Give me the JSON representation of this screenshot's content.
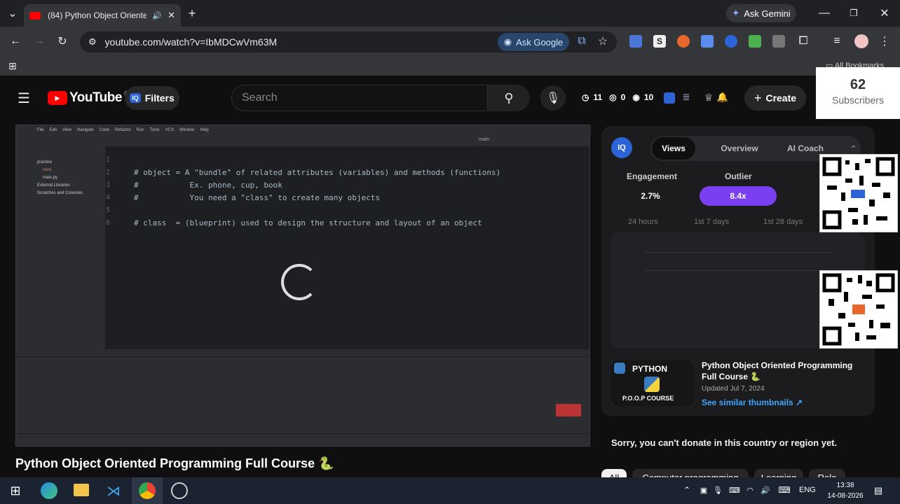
{
  "browser": {
    "tab_title": "(84) Python Object Oriented",
    "new_tab_symbol": "+",
    "ask_gemini": "Ask Gemini",
    "url": "youtube.com/watch?v=IbMDCwVm63M",
    "ask_google": "Ask Google",
    "all_bookmarks": "All Bookmarks"
  },
  "youtube": {
    "logo_text": "YouTube",
    "region": "IN",
    "filters_label": "Filters",
    "search_placeholder": "Search",
    "stat1": "11",
    "stat2": "0",
    "stat3": "10",
    "create_label": "Create",
    "subscribers_count": "62",
    "subscribers_label": "Subscribers"
  },
  "ide": {
    "lines": [
      {
        "n": "1",
        "text": ""
      },
      {
        "n": "2",
        "text": "# object = A \"bundle\" of related attributes (variables) and methods (functions)"
      },
      {
        "n": "3",
        "text": "#           Ex. phone, cup, book"
      },
      {
        "n": "4",
        "text": "#           You need a \"class\" to create many objects"
      },
      {
        "n": "5",
        "text": ""
      },
      {
        "n": "6",
        "text": "# class  = (blueprint) used to design the structure and layout of an object"
      }
    ],
    "project_items": [
      "practice",
      "venv",
      "main.py",
      "External Libraries",
      "Scratches and Consoles"
    ],
    "menu": [
      "File",
      "Edit",
      "View",
      "Navigate",
      "Code",
      "Refactor",
      "Run",
      "Tools",
      "VCS",
      "Window",
      "Help"
    ],
    "run_config": "main"
  },
  "side_panel": {
    "logo": "IQ",
    "tabs": [
      "Views",
      "Overview",
      "AI Coach"
    ],
    "active_tab": "Views",
    "engagement_label": "Engagement",
    "engagement_value": "2.7%",
    "outlier_label": "Outlier",
    "outlier_value": "8.4x",
    "periods": [
      "24 hours",
      "1st 7 days",
      "1st 28 days"
    ],
    "video_title": "Python Object Oriented Programming Full Course 🐍",
    "updated": "Updated Jul 7, 2024",
    "see_similar": "See similar thumbnails ↗",
    "thumb_title": "PYTHON",
    "thumb_subtitle": "P.O.O.P COURSE"
  },
  "donate_notice": "Sorry, you can't donate in this country or region yet.",
  "video_title": "Python Object Oriented Programming Full Course 🐍",
  "chips": [
    "All",
    "Computer programming",
    "Learning",
    "Rela"
  ],
  "taskbar": {
    "language": "ENG",
    "time": "13:38",
    "date": "14-08-2026"
  },
  "colors": {
    "outlier": "#7b3ff2",
    "youtube_red": "#ff0000",
    "link": "#3ea6ff"
  }
}
